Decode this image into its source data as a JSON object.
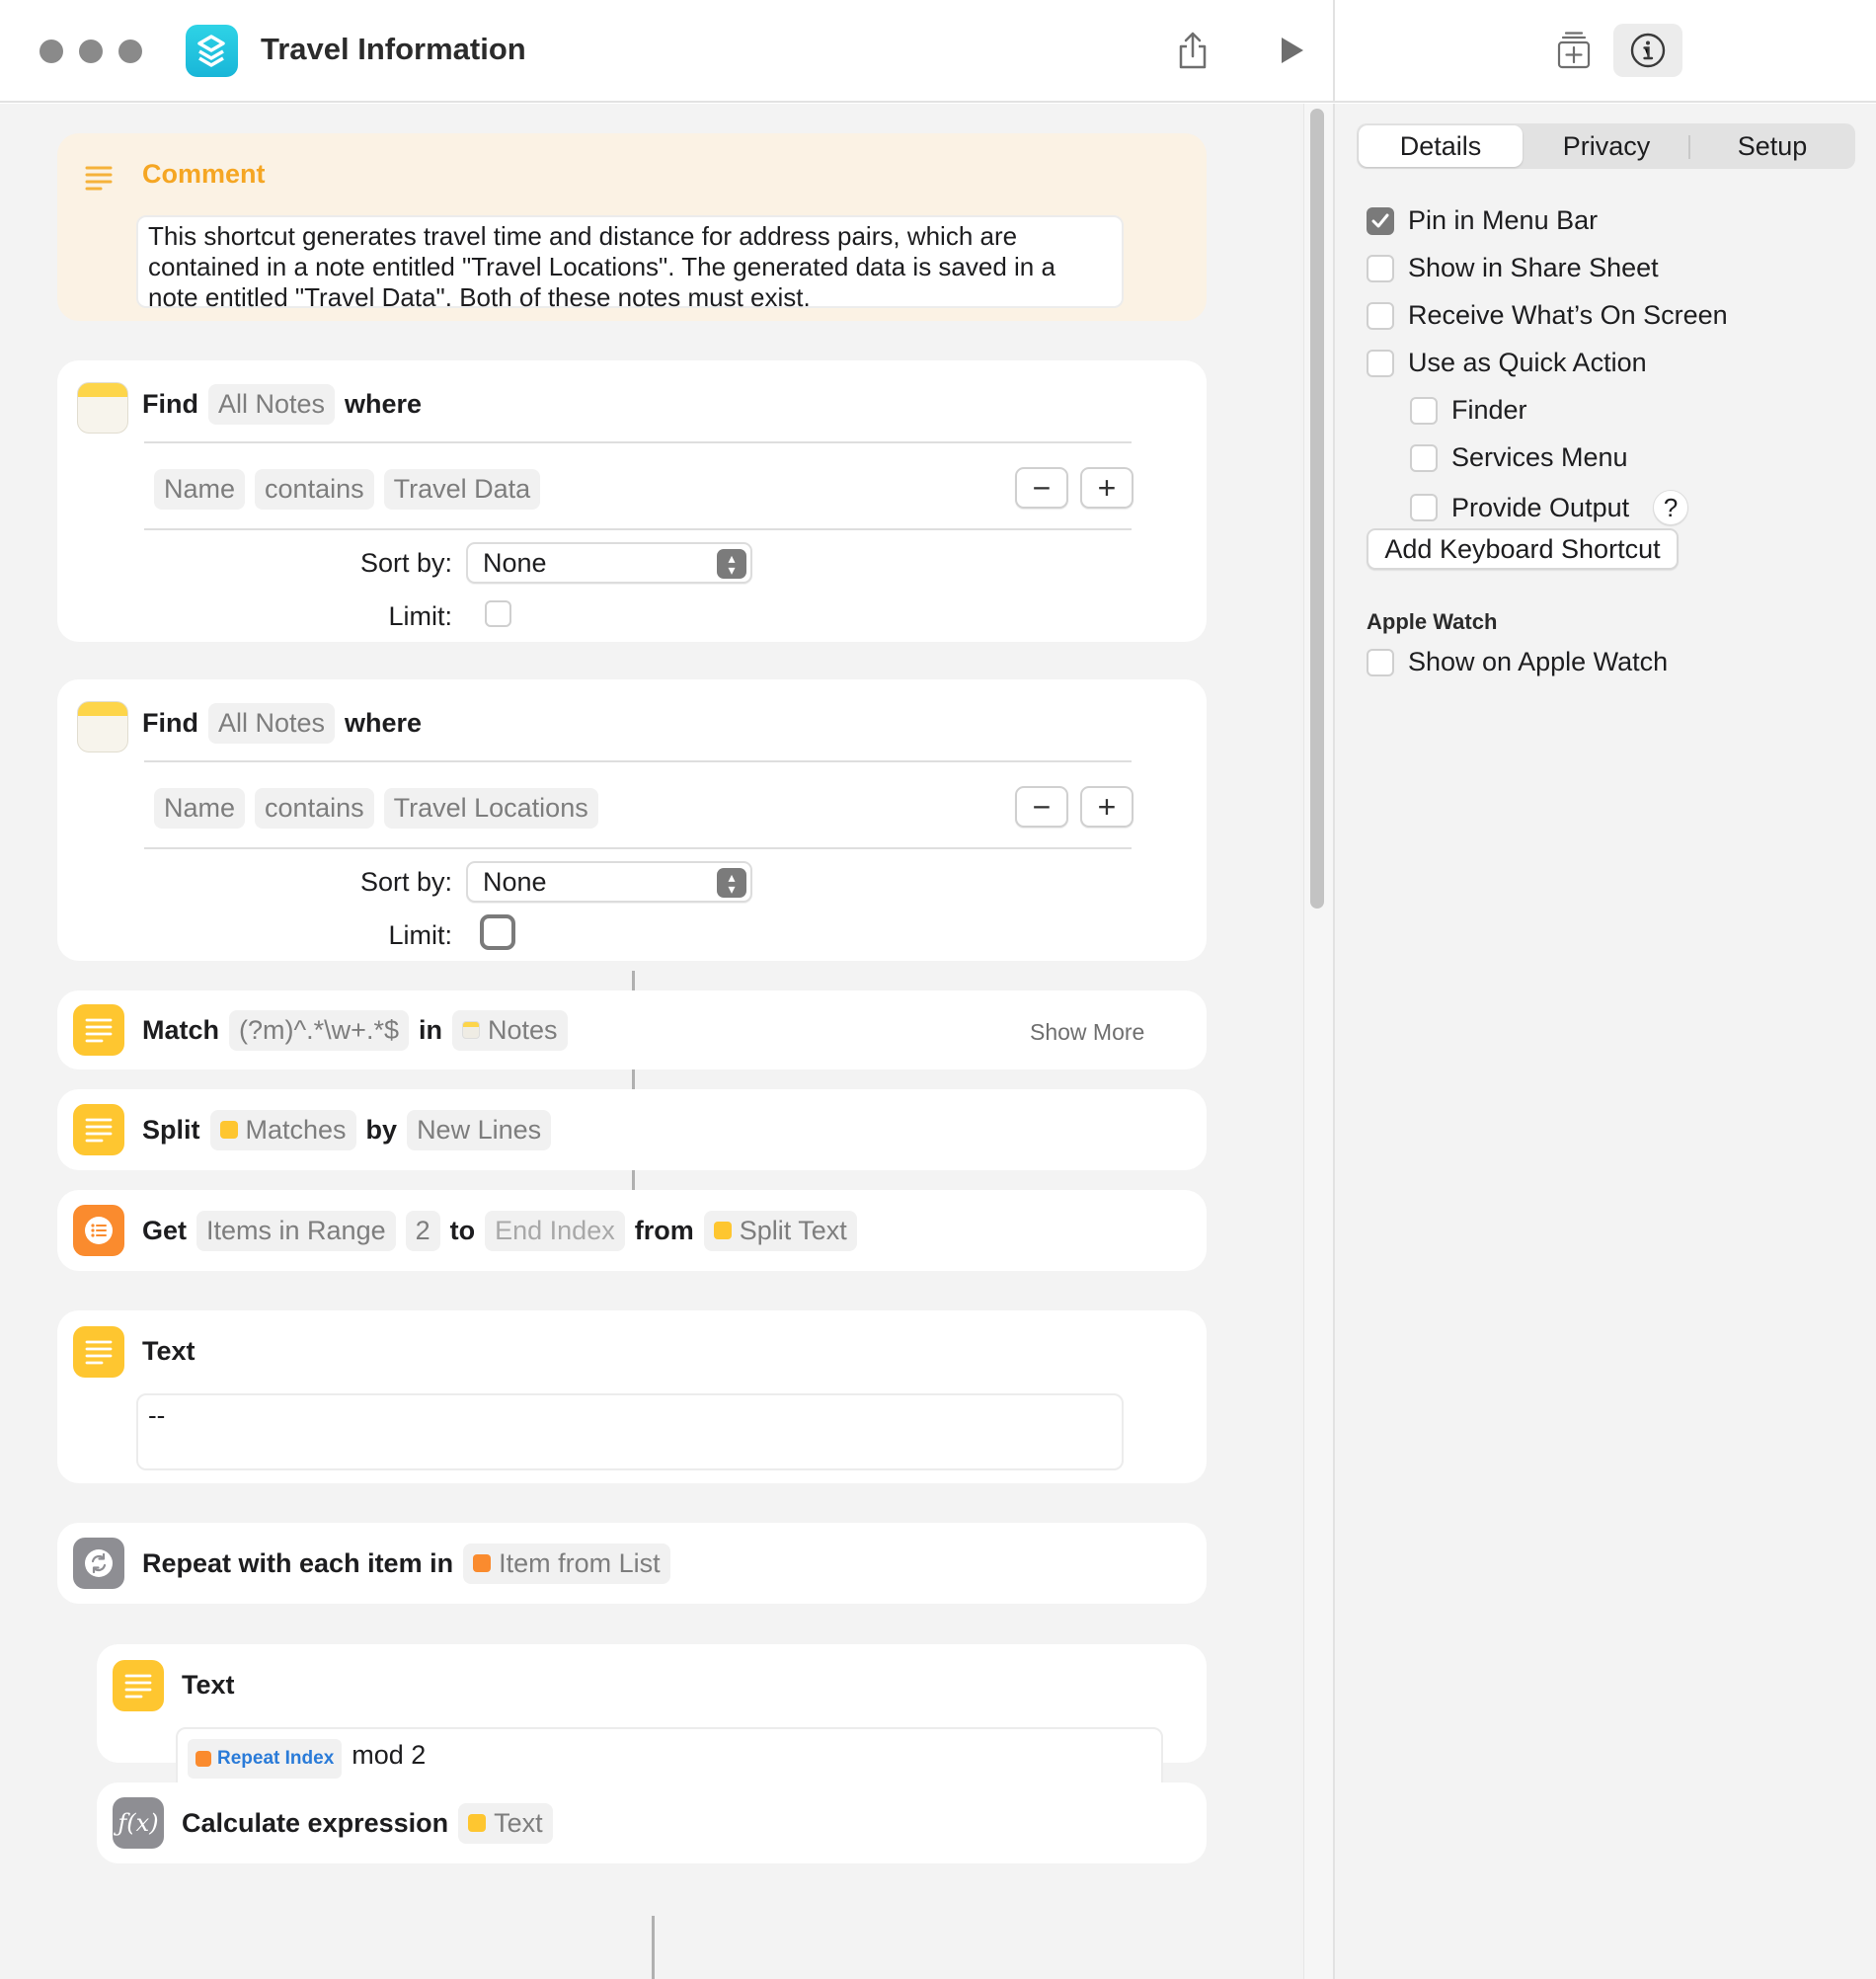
{
  "window": {
    "title": "Travel Information",
    "icons": [
      "share-icon",
      "play-icon",
      "add-to-library-icon",
      "info-icon"
    ]
  },
  "comment": {
    "label": "Comment",
    "text": "This shortcut generates travel time and distance for address pairs, which are contained in a note entitled \"Travel Locations\". The generated data is saved in a note entitled \"Travel Data\". Both of these notes must exist."
  },
  "find1": {
    "verb": "Find",
    "source": "All Notes",
    "where": "where",
    "filter": {
      "field": "Name",
      "op": "contains",
      "value": "Travel Data"
    },
    "sort_label": "Sort by:",
    "sort_value": "None",
    "limit_label": "Limit:"
  },
  "find2": {
    "verb": "Find",
    "source": "All Notes",
    "where": "where",
    "filter": {
      "field": "Name",
      "op": "contains",
      "value": "Travel Locations"
    },
    "sort_label": "Sort by:",
    "sort_value": "None",
    "limit_label": "Limit:"
  },
  "match": {
    "verb": "Match",
    "pattern": "(?m)^.*\\w+.*$",
    "in": "in",
    "var": "Notes",
    "show_more": "Show More"
  },
  "split": {
    "verb": "Split",
    "var": "Matches",
    "by": "by",
    "sep": "New Lines"
  },
  "get": {
    "verb": "Get",
    "what": "Items in Range",
    "start": "2",
    "to": "to",
    "end": "End Index",
    "from": "from",
    "var": "Split Text"
  },
  "text1": {
    "title": "Text",
    "content": "--"
  },
  "repeat": {
    "label": "Repeat with each item in",
    "var": "Item from List"
  },
  "text2": {
    "title": "Text",
    "var": "Repeat Index",
    "suffix": "mod 2"
  },
  "calc": {
    "label": "Calculate expression",
    "var": "Text",
    "icon_text": "ƒ(x)"
  },
  "side": {
    "tabs": [
      "Details",
      "Privacy",
      "Setup"
    ],
    "selected_tab": "Details",
    "options": [
      {
        "label": "Pin in Menu Bar",
        "checked": true
      },
      {
        "label": "Show in Share Sheet",
        "checked": false
      },
      {
        "label": "Receive What’s On Screen",
        "checked": false
      },
      {
        "label": "Use as Quick Action",
        "checked": false
      }
    ],
    "sub_options": [
      {
        "label": "Finder",
        "checked": false
      },
      {
        "label": "Services Menu",
        "checked": false
      },
      {
        "label": "Provide Output",
        "checked": false
      }
    ],
    "help": "?",
    "keyboard_button": "Add Keyboard Shortcut",
    "watch_header": "Apple Watch",
    "watch_option": {
      "label": "Show on Apple Watch",
      "checked": false
    }
  }
}
